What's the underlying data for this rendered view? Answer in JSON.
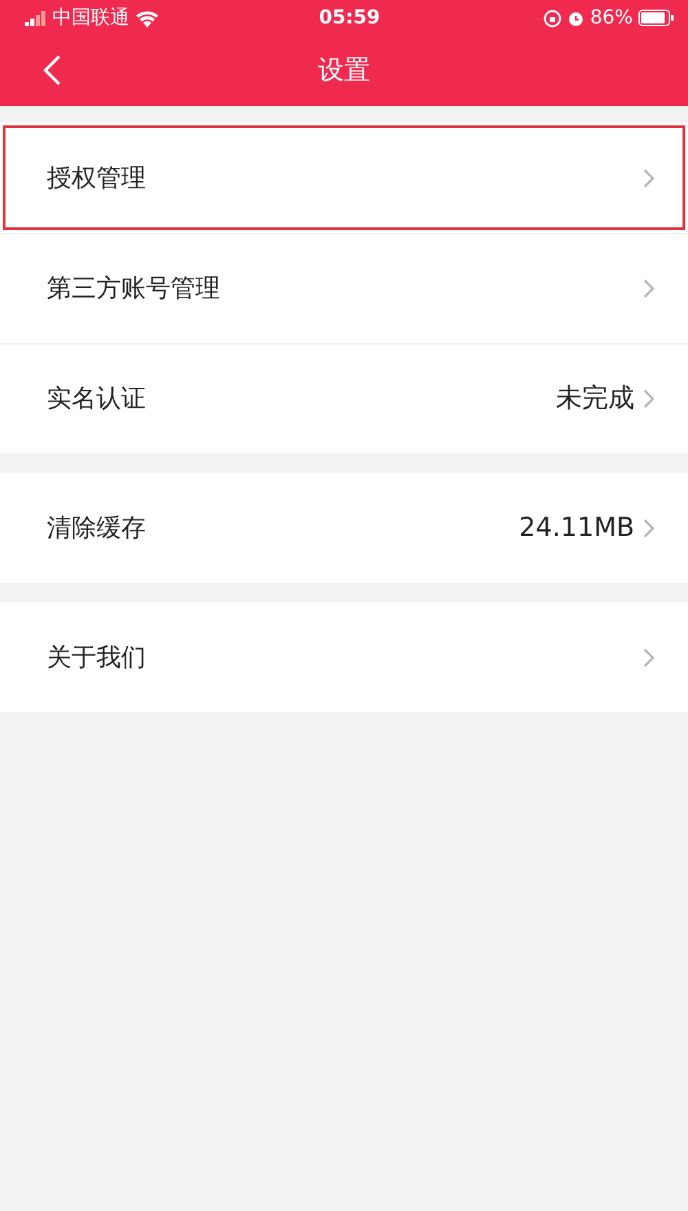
{
  "status_bar": {
    "carrier": "中国联通",
    "time": "05:59",
    "battery": "86%"
  },
  "nav": {
    "title": "设置"
  },
  "groups": [
    {
      "items": [
        {
          "label": "授权管理",
          "highlighted": true
        },
        {
          "label": "第三方账号管理",
          "highlighted": false
        },
        {
          "label": "实名认证",
          "value": "未完成",
          "highlighted": false
        }
      ]
    },
    {
      "items": [
        {
          "label": "清除缓存",
          "value": "24.11MB",
          "highlighted": false
        }
      ]
    },
    {
      "items": [
        {
          "label": "关于我们",
          "highlighted": false
        }
      ]
    }
  ]
}
